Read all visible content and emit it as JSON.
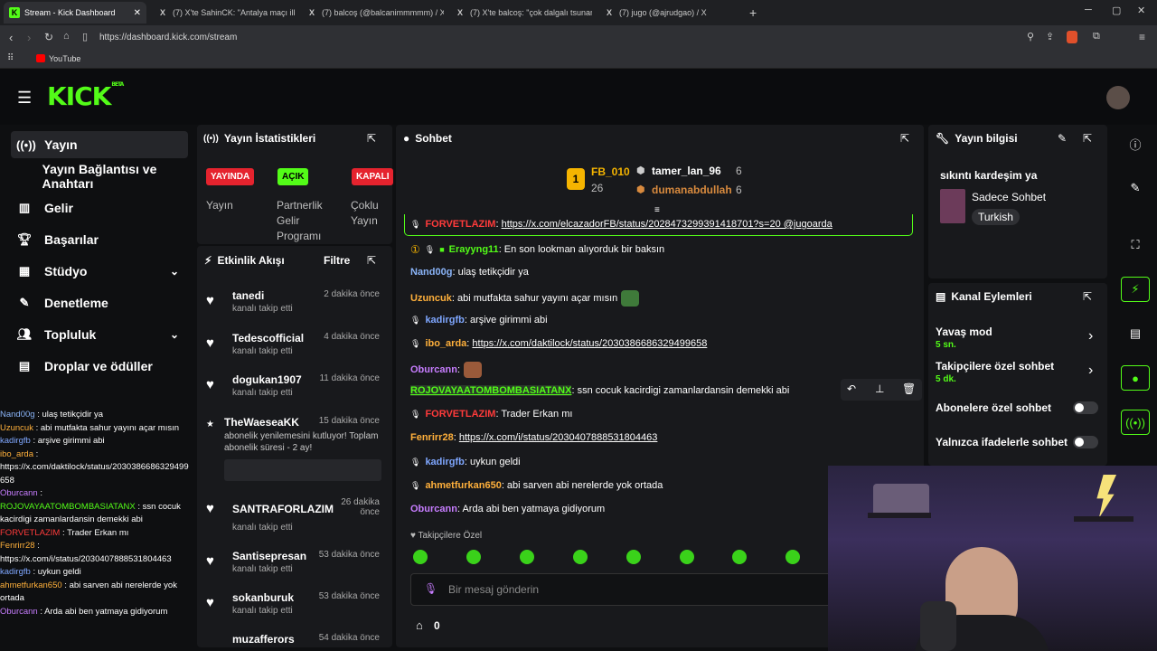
{
  "browser": {
    "tabs": [
      {
        "label": "Stream - Kick Dashboard",
        "icon": "K"
      },
      {
        "label": "(7) X'te SahinCK: \"Antalya maçı ilk 11",
        "icon": "X"
      },
      {
        "label": "(7) balcoş (@balcanimmmmm) / X",
        "icon": "X"
      },
      {
        "label": "(7) X'te balcoş: \"çok dalgalı tsunami",
        "icon": "X"
      },
      {
        "label": "(7) jugo (@ajrudgao) / X",
        "icon": "X"
      }
    ],
    "url": "https://dashboard.kick.com/stream",
    "bookmark": "YouTube"
  },
  "brand": {
    "logo": "KICK",
    "beta": "BETA",
    "accent": "#53fc18"
  },
  "sidebar": {
    "items": [
      {
        "label": "Yayın",
        "icon": "broadcast-icon"
      },
      {
        "label": "Yayın Bağlantısı ve Anahtarı",
        "icon": ""
      },
      {
        "label": "Gelir",
        "icon": "chart-icon"
      },
      {
        "label": "Başarılar",
        "icon": "trophy-icon"
      },
      {
        "label": "Stüdyo",
        "icon": "studio-icon"
      },
      {
        "label": "Denetleme",
        "icon": "wrench-icon"
      },
      {
        "label": "Topluluk",
        "icon": "people-icon"
      },
      {
        "label": "Droplar ve ödüller",
        "icon": "gift-icon"
      }
    ],
    "mini_chat": [
      {
        "user": "Nand00g",
        "color": "#8ab4f8",
        "text": " : ulaş tetikçidir ya"
      },
      {
        "user": "Uzuncuk",
        "color": "#ffb03b",
        "text": " : abi mutfakta sahur yayını açar mısın"
      },
      {
        "user": "kadirgfb",
        "color": "#7fa7ff",
        "text": " : arşive girimmi abi"
      },
      {
        "user": "ibo_arda",
        "color": "#ffb03b",
        "text": " :"
      },
      {
        "user": "",
        "color": "#fff",
        "text": "https://x.com/daktilock/status/2030386686329499"
      },
      {
        "user": "",
        "color": "#fff",
        "text": "658"
      },
      {
        "user": "Oburcann",
        "color": "#c77dff",
        "text": " :"
      },
      {
        "user": "ROJOVAYAATOMBOMBASIATANX",
        "color": "#53fc18",
        "text": " : ssn cocuk"
      },
      {
        "user": "",
        "color": "#fff",
        "text": "kacirdigi zamanlardansin demekki abi"
      },
      {
        "user": "FORVETLAZIM",
        "color": "#ff3b3b",
        "text": " : Trader Erkan mı"
      },
      {
        "user": "Fenrirr28",
        "color": "#ffb03b",
        "text": " :"
      },
      {
        "user": "",
        "color": "#fff",
        "text": "https://x.com/i/status/2030407888531804463"
      },
      {
        "user": "kadirgfb",
        "color": "#7fa7ff",
        "text": " : uykun geldi"
      },
      {
        "user": "ahmetfurkan650",
        "color": "#ffb03b",
        "text": " : abi sarven abi nerelerde yok"
      },
      {
        "user": "",
        "color": "#fff",
        "text": "ortada"
      },
      {
        "user": "Oburcann",
        "color": "#c77dff",
        "text": " : Arda abi ben yatmaya gidiyorum"
      }
    ]
  },
  "stats": {
    "title": "Yayın İstatistikleri",
    "badges": [
      {
        "text": "YAYINDA",
        "label": "Yayın",
        "color": "#e5232e"
      },
      {
        "text": "AÇIK",
        "label": "Partnerlik Gelir Programı",
        "color": "#53fc18"
      },
      {
        "text": "KAPALI",
        "label": "Çoklu Yayın",
        "color": "#e5232e"
      }
    ]
  },
  "activity": {
    "title": "Etkinlik Akışı",
    "filter": "Filtre",
    "events": [
      {
        "name": "tanedi",
        "sub": "kanalı takip etti",
        "time": "2 dakika önce"
      },
      {
        "name": "Tedescofficial",
        "sub": "kanalı takip etti",
        "time": "4 dakika önce"
      },
      {
        "name": "dogukan1907",
        "sub": "kanalı takip etti",
        "time": "11 dakika önce"
      },
      {
        "name": "TheWaeseaKK",
        "sub": "abonelik yenilemesini kutluyor! Toplam abonelik süresi - 2 ay!",
        "time": "15 dakika önce"
      },
      {
        "name": "SANTRAFORLAZIM",
        "sub": "kanalı takip etti",
        "time": "26 dakika önce"
      },
      {
        "name": "Santisepresan",
        "sub": "kanalı takip etti",
        "time": "53 dakika önce"
      },
      {
        "name": "sokanburuk",
        "sub": "kanalı takip etti",
        "time": "53 dakika önce"
      },
      {
        "name": "muzafferors",
        "sub": "",
        "time": "54 dakika önce"
      }
    ]
  },
  "chat": {
    "title": "Sohbet",
    "leaders": [
      {
        "name": "FB_010",
        "count": "26"
      },
      {
        "name": "tamer_lan_96",
        "count": "6"
      },
      {
        "name": "dumanabdullah",
        "count": "6"
      }
    ],
    "pinned": {
      "user": "FORVETLAZIM",
      "text": "https://x.com/elcazadorFB/status/2028473299391418701?s=20 @jugoarda"
    },
    "messages": [
      {
        "user": "Erayyng11",
        "color": "#53fc18",
        "text": ": En son lookman alıyorduk bir baksın",
        "link": false,
        "badge": "sub"
      },
      {
        "user": "Nand00g",
        "color": "#8ab4f8",
        "text": ": ulaş tetikçidir ya",
        "link": false,
        "badge": ""
      },
      {
        "user": "Uzuncuk",
        "color": "#ffb03b",
        "text": ": abi mutfakta sahur yayını açar mısın",
        "link": false,
        "badge": ""
      },
      {
        "user": "kadirgfb",
        "color": "#7fa7ff",
        "text": ": arşive girimmi abi",
        "link": false,
        "badge": "mic"
      },
      {
        "user": "ibo_arda",
        "color": "#ffb03b",
        "text": "https://x.com/daktilock/status/2030386686329499658",
        "link": true,
        "badge": "mic"
      },
      {
        "user": "Oburcann",
        "color": "#c77dff",
        "text": ":",
        "link": false,
        "badge": ""
      },
      {
        "user": "ROJOVAYAATOMBOMBASIATANX",
        "color": "#53fc18",
        "text": ": ssn cocuk kacirdigi zamanlardansin demekki abi",
        "link": false,
        "badge": ""
      },
      {
        "user": "FORVETLAZIM",
        "color": "#ff3b3b",
        "text": ": Trader Erkan mı",
        "link": false,
        "badge": "mic"
      },
      {
        "user": "Fenrirr28",
        "color": "#ffb03b",
        "text": "https://x.com/i/status/2030407888531804463",
        "link": true,
        "badge": ""
      },
      {
        "user": "kadirgfb",
        "color": "#7fa7ff",
        "text": ": uykun geldi",
        "link": false,
        "badge": "mic"
      },
      {
        "user": "ahmetfurkan650",
        "color": "#ffb03b",
        "text": ": abi sarven abi nerelerde yok ortada",
        "link": false,
        "badge": "mic"
      },
      {
        "user": "Oburcann",
        "color": "#c77dff",
        "text": ": Arda abi ben yatmaya gidiyorum",
        "link": false,
        "badge": ""
      }
    ],
    "followers_only": "Takipçilere Özel",
    "input_placeholder": "Bir mesaj gönderin",
    "points": "0"
  },
  "stream_info": {
    "title": "Yayın bilgisi",
    "stream_title": "sıkıntı kardeşim ya",
    "category": "Sadece Sohbet",
    "language": "Turkish"
  },
  "channel_actions": {
    "title": "Kanal Eylemleri",
    "slow_mode": {
      "label": "Yavaş mod",
      "value": "5 sn."
    },
    "followers_chat": {
      "label": "Takipçilere özel sohbet",
      "value": "5 dk."
    },
    "subs_chat": {
      "label": "Abonelere özel sohbet",
      "on": false
    },
    "emote_chat": {
      "label": "Yalnızca ifadelerle sohbet",
      "on": false
    }
  }
}
